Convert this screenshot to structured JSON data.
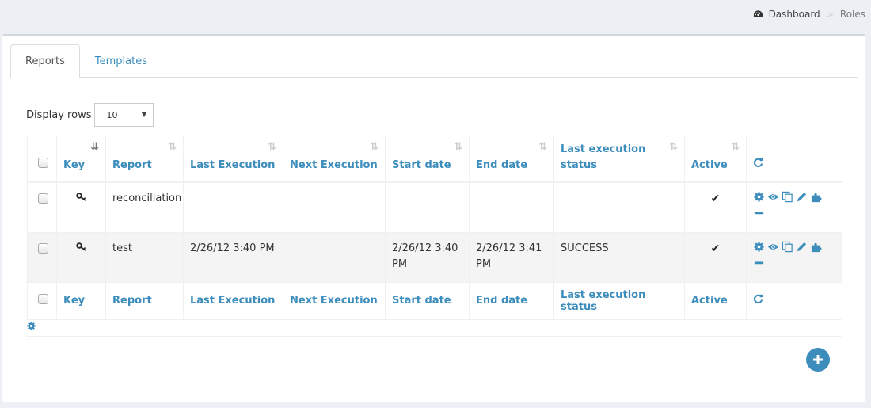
{
  "breadcrumb": {
    "items": [
      {
        "label": "Dashboard",
        "icon": "dashboard-icon"
      },
      {
        "label": "Roles"
      }
    ],
    "separator": ">"
  },
  "tabs": [
    {
      "label": "Reports",
      "active": true
    },
    {
      "label": "Templates",
      "active": false
    }
  ],
  "display_rows": {
    "label": "Display rows",
    "selected": "10"
  },
  "table": {
    "header": {
      "key": "Key",
      "report": "Report",
      "last_execution": "Last Execution",
      "next_execution": "Next Execution",
      "start_date": "Start date",
      "end_date": "End date",
      "last_execution_status": "Last execution status",
      "active": "Active"
    },
    "rows": [
      {
        "key_icon": "key-icon",
        "report": "reconciliation",
        "last_execution": "",
        "next_execution": "",
        "start_date": "",
        "end_date": "",
        "last_execution_status": "",
        "active": "✔"
      },
      {
        "key_icon": "key-icon",
        "report": "test",
        "last_execution": "2/26/12 3:40 PM",
        "next_execution": "",
        "start_date": "2/26/12 3:40 PM",
        "end_date": "2/26/12 3:41 PM",
        "last_execution_status": "SUCCESS",
        "active": "✔"
      }
    ],
    "row_actions": [
      "gear-icon",
      "eye-icon",
      "copy-icon",
      "pencil-icon",
      "puzzle-icon",
      "minus-icon"
    ]
  },
  "colors": {
    "accent": "#3c8dbc",
    "background": "#ecf0f5"
  }
}
